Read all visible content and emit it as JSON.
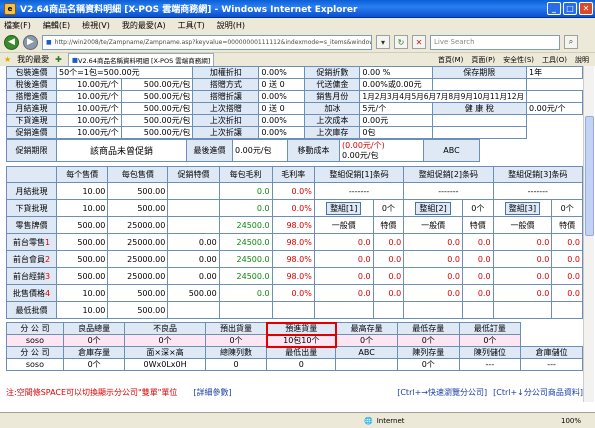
{
  "window": {
    "title": "V2.64商品名稱資料明細 [X-POS 雲端商務網] - Windows Internet Explorer",
    "icon": "ie-icon"
  },
  "menu": [
    "檔案(F)",
    "編輯(E)",
    "檢視(V)",
    "我的最愛(A)",
    "工具(T)",
    "說明(H)"
  ],
  "address": {
    "url": "http://win2008/te/Zampname/Zampname.asp?keyvalue=00000000111112&indexmode=s_items&window",
    "search_placeholder": "Live Search"
  },
  "favorites": {
    "label": "我的最愛",
    "tab_title": "V2.64商品名稱資料明細 [X-POS 雲端商務網]",
    "tools": [
      "首頁(M)",
      "頁面(P)",
      "安全性(S)",
      "工具(O)",
      "說明"
    ]
  },
  "top_rows": [
    [
      "包裝進價",
      "50个=1包=500.00元",
      "加權折扣",
      "0.00%",
      "促銷折數",
      "0.00 %",
      "保存期限",
      "1年"
    ],
    [
      "稅後進價",
      "10.00元/个",
      "500.00元/包",
      "搭贈方式",
      "0 送 0",
      "代送傭金",
      "0.00%或0.00元",
      ""
    ],
    [
      "搭贈進價",
      "10.00元/个",
      "500.00元/包",
      "搭贈折讓",
      "0.00%",
      "銷售月份",
      "1月2月3月4月5月6月7月8月9月10月11月12月",
      ""
    ],
    [
      "月結進現",
      "10.00元/个",
      "500.00元/包",
      "上次搭贈",
      "0 送 0",
      "加冰",
      "5元/个",
      "健 康 稅",
      "0.00元/个"
    ],
    [
      "下貨進現",
      "10.00元/个",
      "500.00元/包",
      "上次折扣",
      "0.00%",
      "上次成本",
      "0.00元",
      ""
    ],
    [
      "促銷進價",
      "10.00元/个",
      "500.00元/包",
      "上次折讓",
      "0.00%",
      "上次庫存",
      "0包",
      ""
    ]
  ],
  "promo": {
    "label": "促銷期限",
    "value": "該商品未曾促銷",
    "last_label": "最後進價",
    "last_value": "0.00元/包",
    "move_label": "移動成本",
    "move_value1": "(0.00元/个)",
    "move_value2": "0.00元/包",
    "abc_label": "ABC"
  },
  "price_headers": [
    "每个售價",
    "每包售價",
    "促銷特價",
    "每包毛利",
    "毛利率",
    "整組促銷[1]条码",
    "整組促銷[2]条码",
    "整組促銷[3]条码"
  ],
  "price_rows": [
    {
      "label": "月結批現",
      "cells": [
        "10.00",
        "500.00",
        "",
        "0.0",
        "0.0%",
        "-------",
        "-------",
        "-------"
      ]
    },
    {
      "label": "下貨批現",
      "cells": [
        "10.00",
        "500.00",
        "",
        "0.0",
        "0.0%",
        "整組[1]",
        "0个",
        "整組[2]",
        "0个",
        "整組[3]",
        "0个"
      ]
    },
    {
      "label": "零售牌價",
      "cells": [
        "500.00",
        "25000.00",
        "",
        "24500.0",
        "98.0%",
        "一般價",
        "特價",
        "一般價",
        "特價",
        "一般價",
        "特價"
      ]
    },
    {
      "label": "前台零售1",
      "cells": [
        "500.00",
        "25000.00",
        "0.00",
        "24500.0",
        "98.0%",
        "0.0",
        "0.0",
        "0.0",
        "0.0",
        "0.0",
        "0.0"
      ]
    },
    {
      "label": "前台會員2",
      "cells": [
        "500.00",
        "25000.00",
        "0.00",
        "24500.0",
        "98.0%",
        "0.0",
        "0.0",
        "0.0",
        "0.0",
        "0.0",
        "0.0"
      ]
    },
    {
      "label": "前台經銷3",
      "cells": [
        "500.00",
        "25000.00",
        "0.00",
        "24500.0",
        "98.0%",
        "0.0",
        "0.0",
        "0.0",
        "0.0",
        "0.0",
        "0.0"
      ]
    },
    {
      "label": "批售價格4",
      "cells": [
        "10.00",
        "500.00",
        "500.00",
        "0.0",
        "0.0%",
        "0.0",
        "0.0",
        "0.0",
        "0.0",
        "0.0",
        "0.0"
      ]
    },
    {
      "label": "最低批價",
      "cells": [
        "10.00",
        "500.00",
        "",
        "",
        "",
        "",
        "",
        "",
        "",
        "",
        ""
      ]
    }
  ],
  "stock_headers1": [
    "分 公 司",
    "良品總量",
    "不良品",
    "預出貨量",
    "預進貨量",
    "最高存量",
    "最低存量",
    "最低訂量"
  ],
  "stock_row1": [
    "soso",
    "0个",
    "0个",
    "0个",
    "10包10个",
    "0个",
    "0个",
    "0个"
  ],
  "stock_headers2": [
    "分 公 司",
    "倉庫存量",
    "面×深×高",
    "總陳列數",
    "最低出量",
    "ABC",
    "陳列存量",
    "陳列儲位",
    "倉庫儲位"
  ],
  "stock_row2": [
    "soso",
    "0个",
    "0Wx0Lx0H",
    "0",
    "0",
    "",
    "0个",
    "---",
    "---"
  ],
  "footer": {
    "note": "注:空間條SPACE可以切換顯示分公司\"雙單\"單位",
    "detail": "[詳細參數]",
    "link1": "[Ctrl+→快速瀏覽分公司]",
    "link2": "[Ctrl+↓分公司商品資料]"
  },
  "status": {
    "zone": "Internet",
    "zoom": "100%"
  }
}
